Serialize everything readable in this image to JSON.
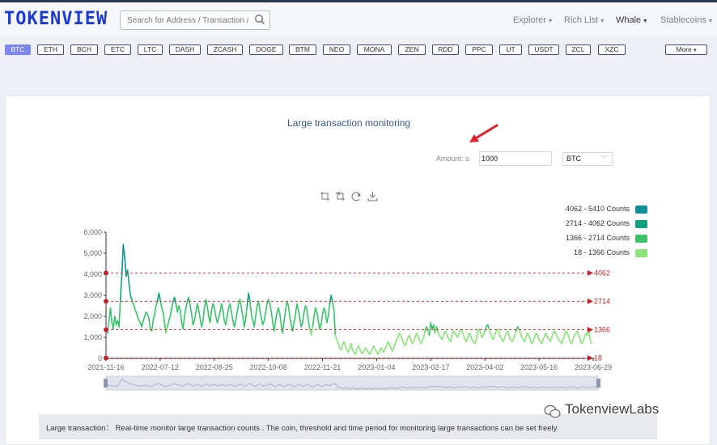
{
  "header": {
    "logo": "TOKENVIEW",
    "search_placeholder": "Search for Address / Transaction / Blc",
    "nav": [
      {
        "label": "Explorer",
        "caret": "▾"
      },
      {
        "label": "Rich List",
        "caret": "▾"
      },
      {
        "label": "Whale",
        "caret": "▾"
      },
      {
        "label": "Stablecoins",
        "caret": "▾"
      }
    ]
  },
  "coins": [
    "BTC",
    "ETH",
    "BCH",
    "ETC",
    "LTC",
    "DASH",
    "ZCASH",
    "DOGE",
    "BTM",
    "NEO",
    "MONA",
    "ZEN",
    "RDD",
    "PPC",
    "UT",
    "USDT",
    "ZCL",
    "XZC"
  ],
  "more_label": "More",
  "active_coin": "BTC",
  "monitor": {
    "title": "Large transaction monitoring",
    "amount_label": "Amount: ≥",
    "amount_value": "1000",
    "coin_value": "BTC"
  },
  "icons": [
    "zoom-select-icon",
    "zoom-reset-icon",
    "restore-icon",
    "download-icon"
  ],
  "chart_data": {
    "type": "line",
    "ylim": [
      0,
      6000
    ],
    "yticks": [
      0,
      1000,
      2000,
      3000,
      4000,
      5000,
      6000
    ],
    "ytick_labels": [
      "0",
      "1,000",
      "2,000",
      "3,000",
      "4,000",
      "5,000",
      "6,000"
    ],
    "xtick_labels": [
      "2021-11-16",
      "2022-07-12",
      "2022-08-25",
      "2022-10-08",
      "2022-11-21",
      "2023-01-04",
      "2023-02-17",
      "2023-04-02",
      "2023-05-16",
      "2023-06-29"
    ],
    "thresholds": [
      4062,
      2714,
      1366,
      18
    ],
    "legend": [
      {
        "label": "4062 - 5410 Counts",
        "color": "#0f8f9a"
      },
      {
        "label": "2714 - 4062 Counts",
        "color": "#13a07e"
      },
      {
        "label": "1366 - 2714 Counts",
        "color": "#3cc26a"
      },
      {
        "label": "18 - 1366 Counts",
        "color": "#8be37a"
      }
    ],
    "series": [
      {
        "values": [
          1200,
          1800,
          2400,
          1700,
          1400,
          2000,
          1600,
          1800,
          1500,
          2800,
          4000,
          5410,
          4800,
          3900,
          4200,
          3600,
          3000,
          2800,
          2600,
          2400,
          2200,
          2000,
          1800,
          1700,
          1500,
          1800,
          2000,
          2200,
          2100,
          1900,
          1400,
          1300,
          1800,
          2100,
          2500,
          2700,
          3100,
          2800,
          2400,
          2200,
          1700,
          1200,
          1500,
          1800,
          2000,
          2400,
          2700,
          2900,
          2600,
          2200,
          2500,
          2300,
          1700,
          1400,
          2000,
          2400,
          2700,
          2900,
          2500,
          2100,
          1600,
          1800,
          2200,
          2600,
          2300,
          1900,
          1500,
          1800,
          2400,
          2800,
          2500,
          2000,
          1700,
          2300,
          2600,
          2400,
          2000,
          1700,
          1900,
          2200,
          2600,
          2300,
          1800,
          1600,
          2000,
          2400,
          2600,
          2200,
          1800,
          1500,
          1800,
          2200,
          2600,
          2800,
          2400,
          2000,
          1500,
          1900,
          2500,
          3100,
          2700,
          2100,
          1800,
          1500,
          2000,
          2500,
          2700,
          2300,
          1900,
          1600,
          1800,
          2200,
          2600,
          2800,
          2600,
          2200,
          1700,
          1300,
          1800,
          2200,
          2400,
          2100,
          1600,
          1200,
          1800,
          2300,
          2700,
          2500,
          2000,
          1600,
          1300,
          1700,
          2100,
          2600,
          2300,
          1900,
          1500,
          1700,
          2200,
          2500,
          2300,
          1800,
          1400,
          1100,
          1500,
          2000,
          2400,
          2200,
          1800,
          1400,
          1600,
          2100,
          2400,
          2200,
          1700,
          2000,
          2600,
          3000,
          2700,
          2300,
          1100,
          900,
          700,
          500,
          400,
          600,
          800,
          600,
          400,
          300,
          500,
          700,
          400,
          300,
          200,
          400,
          600,
          500,
          300,
          250,
          350,
          500,
          400,
          300,
          200,
          300,
          450,
          600,
          400,
          300,
          200,
          350,
          500,
          400,
          300,
          450,
          600,
          800,
          700,
          500,
          350,
          500,
          700,
          900,
          1000,
          1200,
          1100,
          900,
          700,
          600,
          800,
          1000,
          1100,
          900,
          700,
          800,
          1000,
          1200,
          1100,
          900,
          700,
          800,
          1000,
          1300,
          1500,
          1300,
          1100,
          1700,
          1400,
          1600,
          1200,
          1500,
          1300,
          1100,
          1000,
          900,
          1100,
          1300,
          1200,
          1000,
          900,
          800,
          1100,
          1300,
          1200,
          1100,
          1000,
          1200,
          1400,
          1300,
          1100,
          900,
          800,
          1000,
          1200,
          1100,
          900,
          800,
          700,
          900,
          1300,
          1400,
          1200,
          1000,
          1100,
          1300,
          1500,
          1600,
          1400,
          1200,
          1000,
          900,
          1100,
          1300,
          1400,
          1200,
          1000,
          900,
          800,
          1000,
          1200,
          1300,
          1100,
          900,
          800,
          900,
          1100,
          1300,
          1500,
          1400,
          1200,
          1000,
          900,
          800,
          1000,
          1200,
          1100,
          900,
          700,
          800,
          1000,
          1200,
          1100,
          900,
          800,
          700,
          900,
          1100,
          1200,
          1000,
          900,
          800,
          1000,
          1200,
          1300,
          1200,
          1000,
          900,
          800,
          700,
          900,
          1100,
          1300,
          1200,
          1000,
          800,
          700,
          900,
          1100,
          1200,
          1300,
          1100,
          900,
          700,
          800,
          1000,
          1200,
          1100,
          1300,
          900,
          700
        ]
      }
    ]
  },
  "footer_text": "Large transaction： Real-time monitor large transaction counts . The coin, threshold and time period for monitoring large transactions can be set freely.",
  "watermark": "TokenviewLabs"
}
